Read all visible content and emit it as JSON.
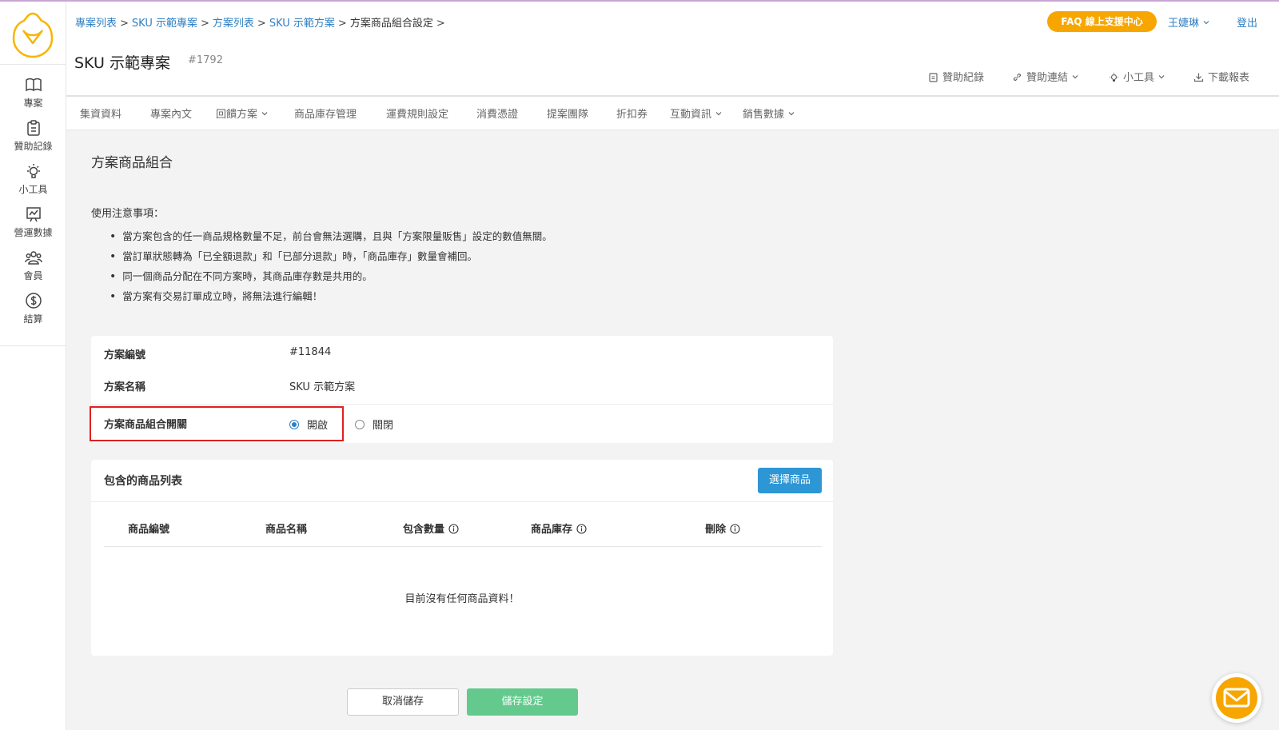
{
  "colors": {
    "accent": "#2f7fc1",
    "faq": "#f7a600",
    "save": "#63c98c",
    "primary_button": "#2d96d4",
    "highlight": "#e02020"
  },
  "sidebar": {
    "items": [
      {
        "label": "專案",
        "icon": "book-icon"
      },
      {
        "label": "贊助記錄",
        "icon": "clipboard-icon"
      },
      {
        "label": "小工具",
        "icon": "lightbulb-icon"
      },
      {
        "label": "營運數據",
        "icon": "chart-icon"
      },
      {
        "label": "會員",
        "icon": "users-icon"
      },
      {
        "label": "結算",
        "icon": "dollar-icon"
      }
    ]
  },
  "breadcrumb": {
    "items": [
      "專案列表",
      "SKU 示範專案",
      "方案列表",
      "SKU 示範方案"
    ],
    "current": "方案商品組合設定",
    "separator": ">"
  },
  "header": {
    "faq": "FAQ 線上支援中心",
    "user": "王婕琳",
    "logout": "登出",
    "project_title": "SKU 示範專案",
    "project_id": "#1792",
    "tools": {
      "sponsor_records": "贊助紀錄",
      "sponsor_links": "贊助連結",
      "tools": "小工具",
      "download": "下載報表"
    }
  },
  "tabs": [
    "集資資料",
    "專案內文",
    "回饋方案",
    "商品庫存管理",
    "運費規則設定",
    "消費憑證",
    "提案團隊",
    "折扣券",
    "互動資訊",
    "銷售數據"
  ],
  "main": {
    "title": "方案商品組合",
    "notice_title": "使用注意事項：",
    "notices": [
      "當方案包含的任一商品規格數量不足，前台會無法選購，且與「方案限量販售」設定的數值無關。",
      "當訂單狀態轉為「已全額退款」和「已部分退款」時，「商品庫存」數量會補回。",
      "同一個商品分配在不同方案時，其商品庫存數是共用的。",
      "當方案有交易訂單成立時，將無法進行編輯！"
    ],
    "plan": {
      "id_label": "方案編號",
      "id_value": "#11844",
      "name_label": "方案名稱",
      "name_value": "SKU 示範方案",
      "toggle_label": "方案商品組合開關",
      "on": "開啟",
      "off": "關閉",
      "selected": "on"
    },
    "products": {
      "title": "包含的商品列表",
      "choose_button": "選擇商品",
      "columns": [
        "商品編號",
        "商品名稱",
        "包含數量",
        "商品庫存",
        "刪除"
      ],
      "empty": "目前沒有任何商品資料！"
    },
    "actions": {
      "cancel": "取消儲存",
      "save": "儲存設定"
    }
  }
}
